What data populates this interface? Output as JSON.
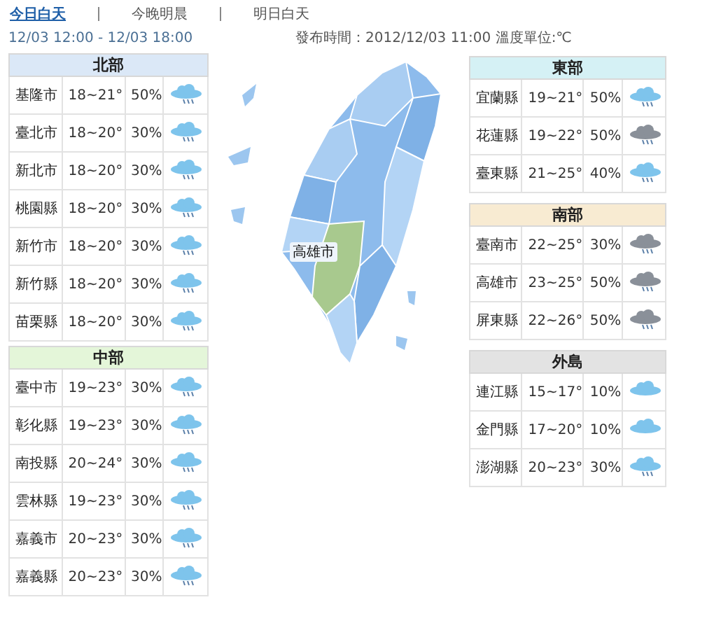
{
  "tabs": [
    {
      "label": "今日白天",
      "selected": true
    },
    {
      "label": "今晚明晨",
      "selected": false
    },
    {
      "label": "明日白天",
      "selected": false
    }
  ],
  "period": "12/03 12:00 - 12/03 18:00",
  "issued": "發布時間：2012/12/03 11:00 溫度單位:℃",
  "map": {
    "label": "高雄市"
  },
  "left_regions": [
    {
      "title": "北部",
      "color": "#dbe8f7",
      "rows": [
        {
          "city": "基隆市",
          "temp": "18~21°",
          "rain": "50%",
          "kind": "rain"
        },
        {
          "city": "臺北市",
          "temp": "18~20°",
          "rain": "30%",
          "kind": "rain"
        },
        {
          "city": "新北市",
          "temp": "18~20°",
          "rain": "30%",
          "kind": "rain"
        },
        {
          "city": "桃園縣",
          "temp": "18~20°",
          "rain": "30%",
          "kind": "rain"
        },
        {
          "city": "新竹市",
          "temp": "18~20°",
          "rain": "30%",
          "kind": "rain"
        },
        {
          "city": "新竹縣",
          "temp": "18~20°",
          "rain": "30%",
          "kind": "rain"
        },
        {
          "city": "苗栗縣",
          "temp": "18~20°",
          "rain": "30%",
          "kind": "rain"
        }
      ]
    },
    {
      "title": "中部",
      "color": "#e4f6d9",
      "rows": [
        {
          "city": "臺中市",
          "temp": "19~23°",
          "rain": "30%",
          "kind": "rain"
        },
        {
          "city": "彰化縣",
          "temp": "19~23°",
          "rain": "30%",
          "kind": "rain"
        },
        {
          "city": "南投縣",
          "temp": "20~24°",
          "rain": "30%",
          "kind": "rain"
        },
        {
          "city": "雲林縣",
          "temp": "19~23°",
          "rain": "30%",
          "kind": "rain"
        },
        {
          "city": "嘉義市",
          "temp": "20~23°",
          "rain": "30%",
          "kind": "rain"
        },
        {
          "city": "嘉義縣",
          "temp": "20~23°",
          "rain": "30%",
          "kind": "rain"
        }
      ]
    }
  ],
  "right_regions": [
    {
      "title": "東部",
      "color": "#d5f1f5",
      "rows": [
        {
          "city": "宜蘭縣",
          "temp": "19~21°",
          "rain": "50%",
          "kind": "rain"
        },
        {
          "city": "花蓮縣",
          "temp": "19~22°",
          "rain": "50%",
          "kind": "storm"
        },
        {
          "city": "臺東縣",
          "temp": "21~25°",
          "rain": "40%",
          "kind": "rain"
        }
      ]
    },
    {
      "title": "南部",
      "color": "#f8ebd2",
      "rows": [
        {
          "city": "臺南市",
          "temp": "22~25°",
          "rain": "30%",
          "kind": "storm"
        },
        {
          "city": "高雄市",
          "temp": "23~25°",
          "rain": "50%",
          "kind": "storm"
        },
        {
          "city": "屏東縣",
          "temp": "22~26°",
          "rain": "50%",
          "kind": "storm"
        }
      ]
    },
    {
      "title": "外島",
      "color": "#e3e3e3",
      "rows": [
        {
          "city": "連江縣",
          "temp": "15~17°",
          "rain": "10%",
          "kind": "cloudy"
        },
        {
          "city": "金門縣",
          "temp": "17~20°",
          "rain": "10%",
          "kind": "cloudy"
        },
        {
          "city": "澎湖縣",
          "temp": "20~23°",
          "rain": "30%",
          "kind": "rain"
        }
      ]
    }
  ]
}
